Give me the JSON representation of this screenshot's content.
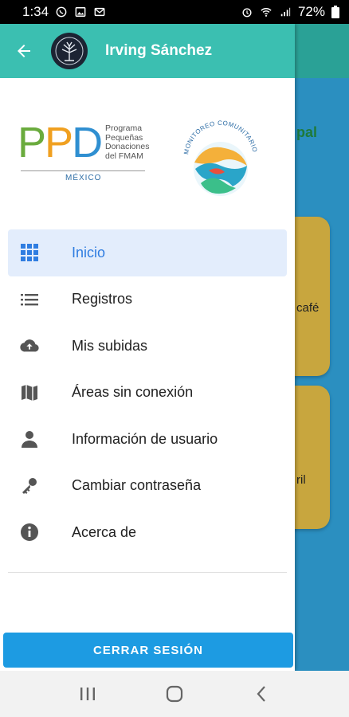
{
  "status_bar": {
    "time": "1:34",
    "battery": "72%"
  },
  "header": {
    "user_name": "Irving Sánchez"
  },
  "logos": {
    "ppd_letters": [
      "P",
      "P",
      "D"
    ],
    "ppd_subtitle": [
      "Programa",
      "Pequeñas",
      "Donaciones",
      "del FMAM"
    ],
    "ppd_country": "MÉXICO",
    "mc_text": "MONITOREO COMUNITARIO"
  },
  "menu": [
    {
      "label": "Inicio",
      "icon": "grid-icon",
      "active": true
    },
    {
      "label": "Registros",
      "icon": "list-icon",
      "active": false
    },
    {
      "label": "Mis subidas",
      "icon": "cloud-upload-icon",
      "active": false
    },
    {
      "label": "Áreas sin conexión",
      "icon": "map-icon",
      "active": false
    },
    {
      "label": "Información de usuario",
      "icon": "person-icon",
      "active": false
    },
    {
      "label": "Cambiar contraseña",
      "icon": "key-icon",
      "active": false
    },
    {
      "label": "Acerca de",
      "icon": "info-icon",
      "active": false
    }
  ],
  "logout_label": "CERRAR SESIÓN",
  "background": {
    "title_fragment": "pal",
    "card1_text": "café",
    "card2_text": "ril"
  },
  "colors": {
    "header": "#3bbfb1",
    "accent": "#2f7de1",
    "logout": "#1d9be2",
    "active_bg": "#e3edfc"
  }
}
